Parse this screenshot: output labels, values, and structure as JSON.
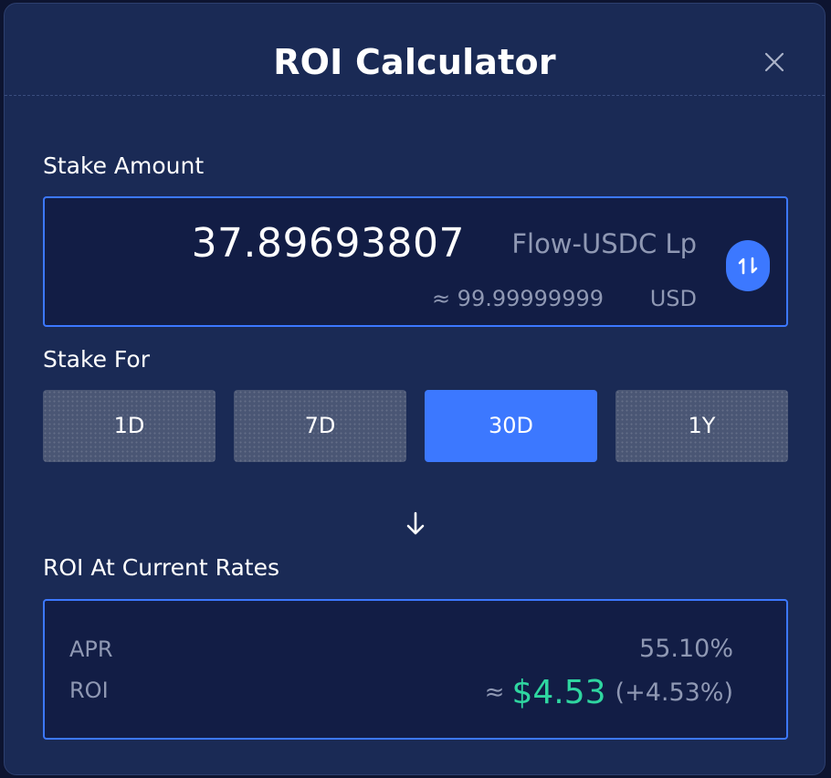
{
  "header": {
    "title": "ROI Calculator",
    "close_icon": "close-icon"
  },
  "stake_amount": {
    "label": "Stake Amount",
    "amount": "37.89693807",
    "token": "Flow-USDC Lp",
    "usd_approx": "≈ 99.99999999",
    "usd_unit": "USD",
    "swap_icon": "swap-icon"
  },
  "stake_for": {
    "label": "Stake For",
    "options": [
      "1D",
      "7D",
      "30D",
      "1Y"
    ],
    "selected": "30D"
  },
  "arrow_icon": "arrow-down-icon",
  "roi": {
    "section_label": "ROI At Current Rates",
    "apr_label": "APR",
    "apr_value": "55.10%",
    "roi_label": "ROI",
    "roi_approx": "≈",
    "roi_amount": "$4.53",
    "roi_percent": "(+4.53%)"
  },
  "colors": {
    "background": "#1a2a55",
    "accent": "#3c78ff",
    "positive": "#2fd6a0",
    "muted_text": "#8f98b3"
  }
}
